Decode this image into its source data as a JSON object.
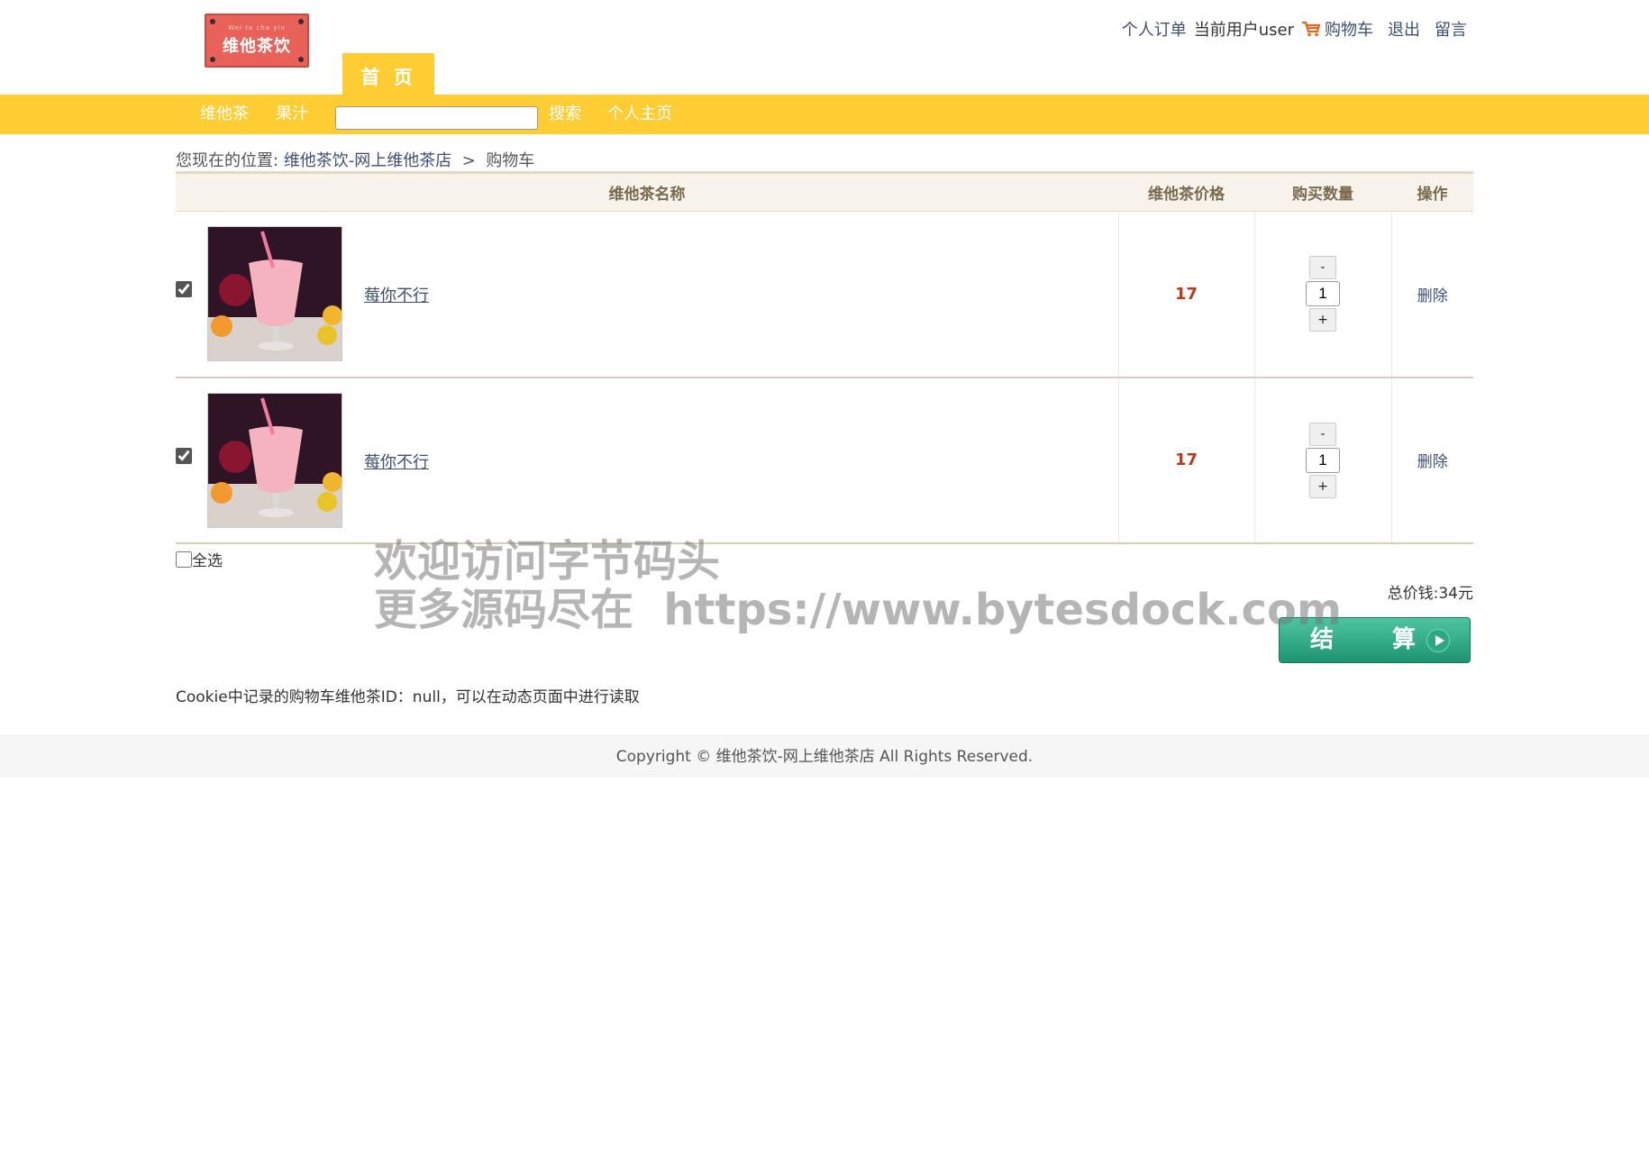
{
  "header": {
    "logo_small": "Wei ta cha yin",
    "logo_name": "维他茶饮",
    "home_tab": "首 页",
    "links": {
      "orders": "个人订单",
      "current_user": "当前用户user",
      "cart": "购物车",
      "logout": "退出",
      "message": "留言"
    }
  },
  "nav": {
    "items": [
      "维他茶",
      "果汁"
    ],
    "search_value": "",
    "search_button": "搜索",
    "profile": "个人主页"
  },
  "breadcrumb": {
    "prefix": "您现在的位置:",
    "home": "维他茶饮-网上维他茶店",
    "sep": " > ",
    "current": "购物车"
  },
  "table": {
    "headers": [
      "维他茶名称",
      "维他茶价格",
      "购买数量",
      "操作"
    ],
    "rows": [
      {
        "checked": true,
        "name": "莓你不行",
        "price": "17",
        "qty": "1",
        "delete": "删除",
        "minus": "-",
        "plus": "+"
      },
      {
        "checked": true,
        "name": "莓你不行",
        "price": "17",
        "qty": "1",
        "delete": "删除",
        "minus": "-",
        "plus": "+"
      }
    ]
  },
  "select_all_label": "全选",
  "total_text": "总价钱:34元",
  "checkout_label": "结 算",
  "cookie_note": "Cookie中记录的购物车维他茶ID：null，可以在动态页面中进行读取",
  "footer": "Copyright © 维他茶饮-网上维他茶店 All Rights Reserved.",
  "watermark": {
    "line1": "欢迎访问字节码头",
    "line2": "更多源码尽在  https://www.bytesdock.com"
  },
  "colors": {
    "accent_yellow": "#fecd34",
    "price_red": "#c0381c",
    "link_blue": "#3d4f73",
    "checkout_green": "#1e9570"
  }
}
